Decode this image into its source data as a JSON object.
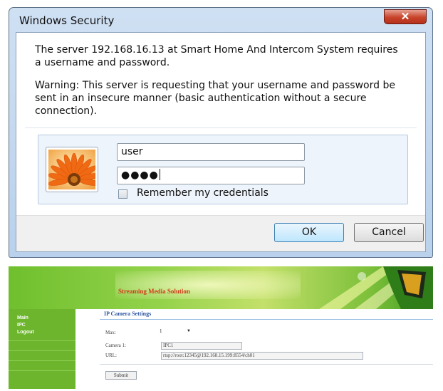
{
  "dialog": {
    "title": "Windows Security",
    "close_glyph": "✕",
    "message": "The server 192.168.16.13 at Smart Home And Intercom System requires a username and password.",
    "warning": "Warning: This server is requesting that your username and password be sent in an insecure manner (basic authentication without a secure connection).",
    "username_value": "user",
    "password_mask": "●●●●",
    "remember_label": "Remember my credentials",
    "remember_checked": false,
    "ok_label": "OK",
    "cancel_label": "Cancel",
    "user_tile_icon": "flower-icon"
  },
  "web": {
    "banner_title": "Streaming Media Solution",
    "sidebar": [
      "Main",
      "IPC",
      "Logout"
    ],
    "content_title": "IP Camera Settings",
    "max_label": "Max:",
    "max_value": "1",
    "camera1_label": "Camera 1:",
    "camera1_value": "IPC1",
    "url_label": "URL:",
    "url_value": "rtsp://root:12345@192.168.15.199:8554/ch01",
    "submit_label": "Submit"
  },
  "colors": {
    "dialog_frame": "#b9d1ec",
    "close_button": "#c7432a",
    "banner_green": "#93d24a",
    "sidebar_green": "#6cb52c",
    "content_title_blue": "#2b55a0"
  }
}
